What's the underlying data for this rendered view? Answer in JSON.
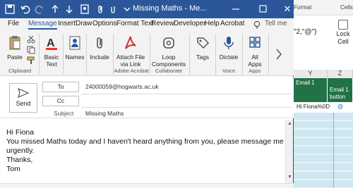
{
  "window": {
    "title": "Missing Maths  -  Me...",
    "close": "✕"
  },
  "menu": {
    "items": [
      "File",
      "Message",
      "Insert",
      "Draw",
      "Options",
      "Format Text",
      "Review",
      "Developer",
      "Help",
      "Acrobat"
    ],
    "tell_me": "Tell me"
  },
  "ribbon": {
    "paste": "Paste",
    "basic_text": "Basic\nText",
    "names": "Names",
    "include": "Include",
    "attach_via_link": "Attach File\nvia Link",
    "loop_components": "Loop\nComponents",
    "tags": "Tags",
    "dictate": "Dictate",
    "all_apps": "All\nApps",
    "groups": {
      "clipboard": "Clipboard",
      "adobe_acrobat": "Adobe Acrobat",
      "collaborate": "Collaborate",
      "voice": "Voice",
      "apps": "Apps"
    }
  },
  "compose": {
    "send": "Send",
    "to_label": "To",
    "to_value": "24000059@hogwarts.ac.uk",
    "cc_label": "Cc",
    "subject_label": "Subject",
    "subject_value": "Missing Maths"
  },
  "message_body": {
    "lines": [
      "Hi Fiona",
      "You missed Maths today and I haven't heard anything from you, please message me",
      "urgently.",
      "Thanks,",
      "Tom"
    ]
  },
  "excel_background": {
    "format_label": "Format",
    "cells_label": "Cells",
    "lock_cell": "Lock\nCell",
    "formula_fragment": "\"2,\"@\")",
    "col_y": "Y",
    "col_z": "Z",
    "header_y": "Email 1",
    "header_z": "Email 1\nbutton",
    "cell_y": "Hi Fiona%0D",
    "cell_z": "@"
  },
  "colors": {
    "titlebar": "#2b579a",
    "excel_header": "#217346",
    "acrobat_red": "#d32f2f"
  }
}
